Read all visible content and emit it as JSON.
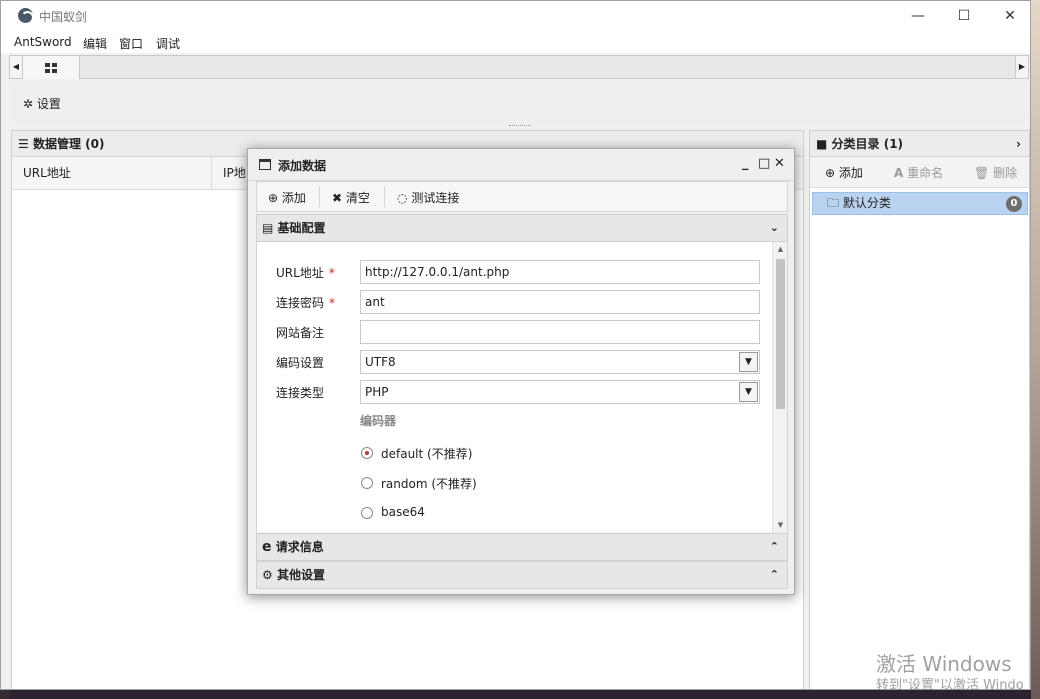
{
  "window": {
    "title": "中国蚁剑",
    "controls": {
      "minimize": "—",
      "maximize": "☐",
      "close": "✕"
    }
  },
  "menu": [
    "AntSword",
    "编辑",
    "窗口",
    "调试"
  ],
  "tabs": {
    "home_icon": "grid-icon"
  },
  "toolbar": {
    "settings": "设置"
  },
  "data_panel": {
    "title": "数据管理 (0)",
    "columns": [
      "URL地址",
      "IP地"
    ]
  },
  "category_panel": {
    "title": "分类目录 (1)",
    "add": "添加",
    "rename": "重命名",
    "delete": "删除",
    "items": [
      {
        "label": "默认分类",
        "count": "0"
      }
    ]
  },
  "modal": {
    "title": "添加数据",
    "toolbar": {
      "add": "添加",
      "clear": "清空",
      "test": "测试连接"
    },
    "sections": {
      "basic": "基础配置",
      "request": "请求信息",
      "other": "其他设置"
    },
    "fields": {
      "url": {
        "label": "URL地址",
        "required": "*",
        "value": "http://127.0.0.1/ant.php"
      },
      "password": {
        "label": "连接密码",
        "required": "*",
        "value": "ant"
      },
      "note": {
        "label": "网站备注",
        "value": ""
      },
      "encoding": {
        "label": "编码设置",
        "value": "UTF8"
      },
      "type": {
        "label": "连接类型",
        "value": "PHP"
      }
    },
    "encoder": {
      "title": "编码器",
      "options": [
        {
          "label": "default (不推荐)",
          "selected": true
        },
        {
          "label": "random (不推荐)",
          "selected": false
        },
        {
          "label": "base64",
          "selected": false
        }
      ]
    }
  },
  "watermark": {
    "line1": "激活 Windows",
    "line2": "转到\"设置\"以激活 Windo"
  }
}
